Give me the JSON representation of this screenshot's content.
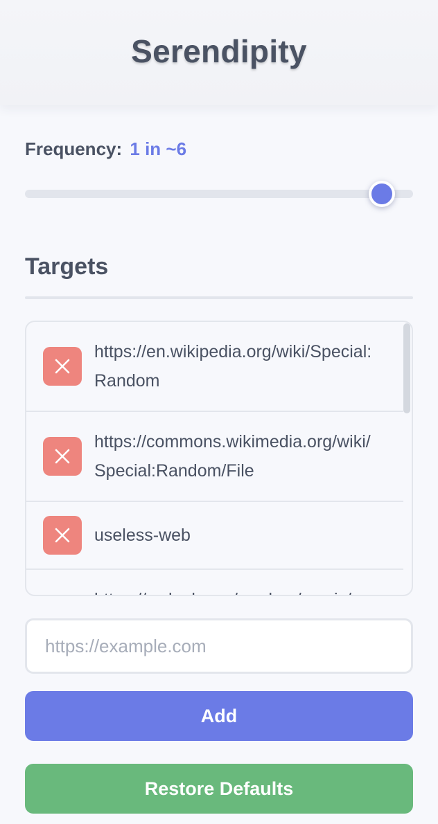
{
  "app": {
    "title": "Serendipity"
  },
  "frequency": {
    "label": "Frequency:",
    "value": "1 in ~6",
    "slider_level_percent": 92
  },
  "targets": {
    "heading": "Targets",
    "items": [
      {
        "url": "https://en.wikipedia.org/wiki/Special:Random"
      },
      {
        "url": "https://commons.wikimedia.org/wiki/Special:Random/File"
      },
      {
        "url": "useless-web"
      },
      {
        "url": "https://c.xkcd.com/random/comic/"
      }
    ]
  },
  "add_form": {
    "placeholder": "https://example.com",
    "value": "",
    "add_label": "Add"
  },
  "restore_label": "Restore Defaults",
  "colors": {
    "accent": "#6b7be6",
    "delete": "#ee857e",
    "restore": "#69b97c",
    "text": "#4a5263"
  },
  "icons": {
    "delete": "close-icon"
  }
}
